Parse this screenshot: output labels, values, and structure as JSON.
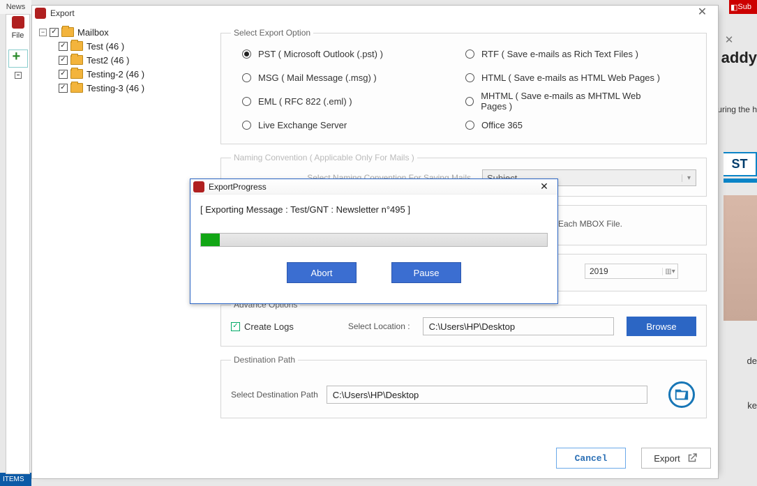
{
  "export_window": {
    "title": "Export",
    "tree": {
      "root_label": "Mailbox",
      "items": [
        {
          "label": "Test (46 )"
        },
        {
          "label": "Test2 (46 )"
        },
        {
          "label": "Testing-2 (46 )"
        },
        {
          "label": "Testing-3 (46 )"
        }
      ]
    },
    "select_export_legend": "Select Export Option",
    "export_options": {
      "pst": "PST ( Microsoft Outlook (.pst) )",
      "rtf": "RTF ( Save e-mails as Rich Text Files )",
      "msg": "MSG ( Mail Message (.msg) )",
      "html": "HTML ( Save e-mails as HTML Web Pages )",
      "eml": "EML ( RFC 822 (.eml) )",
      "mhtml": "MHTML ( Save e-mails as MHTML Web Pages )",
      "live": "Live Exchange Server",
      "o365": "Office 365"
    },
    "naming": {
      "legend": "Naming Convention ( Applicable Only For Mails )",
      "label": "Select Naming Convention For Saving Mails",
      "value": "Subject"
    },
    "split": {
      "text_suffix": "For Each MBOX File."
    },
    "datefilter": {
      "to_value": "2019"
    },
    "advance": {
      "legend": "Advance Options",
      "create_logs": "Create Logs",
      "select_location": "Select Location :",
      "path": "C:\\Users\\HP\\Desktop",
      "browse": "Browse"
    },
    "destination": {
      "legend": "Destination Path",
      "label": "Select Destination Path",
      "path": "C:\\Users\\HP\\Desktop"
    },
    "buttons": {
      "cancel": "Cancel",
      "export": "Export"
    }
  },
  "progress_dialog": {
    "title": "ExportProgress",
    "message": "[ Exporting Message : Test/GNT : Newsletter n°495 ]",
    "progress_percent": 5.5,
    "abort": "Abort",
    "pause": "Pause"
  },
  "background": {
    "news": "News",
    "sub": "Sub",
    "file": "File",
    "daddy": "addy",
    "uring": "uring the h",
    "st": "ST",
    "de": "de",
    "ke": "ke",
    "items": "ITEMS"
  }
}
